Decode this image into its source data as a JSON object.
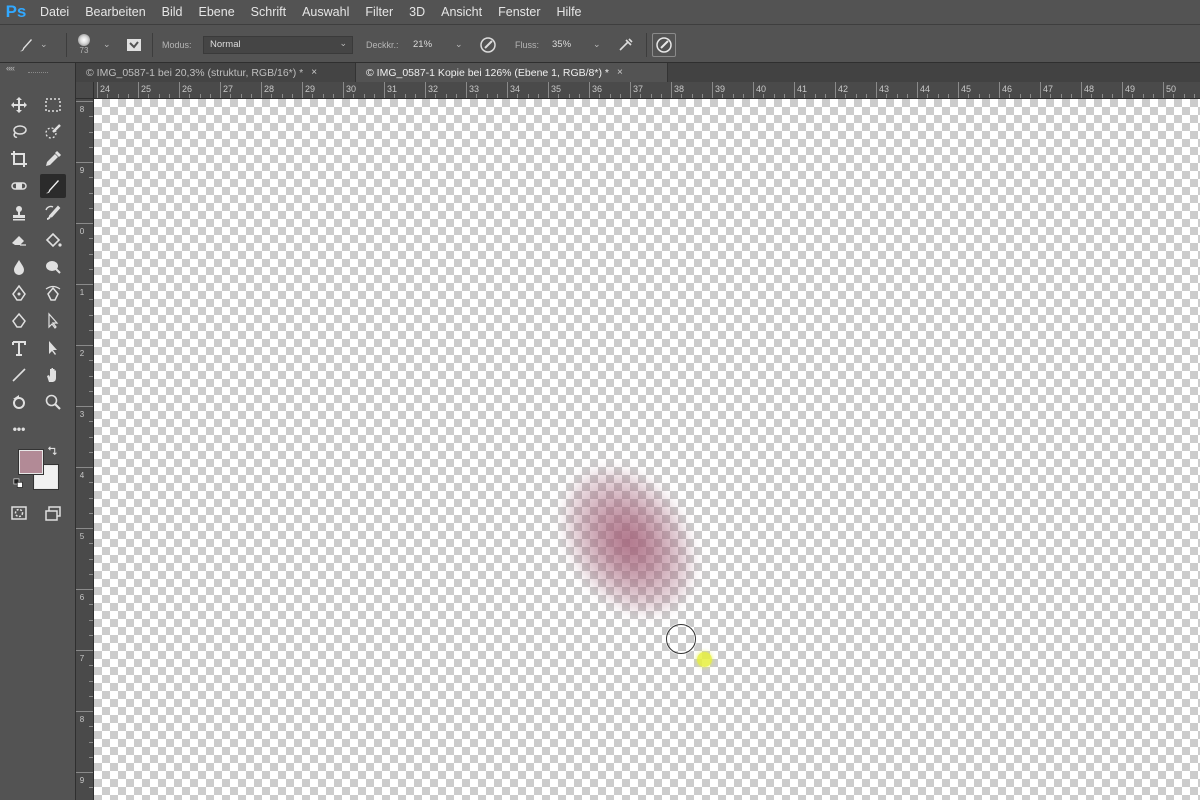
{
  "app": {
    "logo": "Ps"
  },
  "menu": [
    "Datei",
    "Bearbeiten",
    "Bild",
    "Ebene",
    "Schrift",
    "Auswahl",
    "Filter",
    "3D",
    "Ansicht",
    "Fenster",
    "Hilfe"
  ],
  "options": {
    "brush_size": "73",
    "mode_label": "Modus:",
    "mode_value": "Normal",
    "opacity_label": "Deckkr.:",
    "opacity_value": "21%",
    "flow_label": "Fluss:",
    "flow_value": "35%"
  },
  "toolbar": {
    "collapse": "««",
    "more": "•••",
    "foreground_color": "#b28a96",
    "background_color": "#f1f1f1"
  },
  "tabs": [
    {
      "label": "© IMG_0587-1 bei 20,3% (struktur, RGB/16*) *",
      "close": "×",
      "active": false
    },
    {
      "label": "© IMG_0587-1 Kopie bei 126% (Ebene 1, RGB/8*) *",
      "close": "×",
      "active": true
    }
  ],
  "ruler": {
    "horizontal": [
      "24",
      "25",
      "26",
      "27",
      "28",
      "29",
      "30",
      "31",
      "32",
      "33",
      "34",
      "35",
      "36",
      "37",
      "38",
      "39",
      "40",
      "41",
      "42",
      "43",
      "44",
      "45",
      "46",
      "47",
      "48",
      "49",
      "50"
    ],
    "vertical": [
      "8",
      "9",
      "0",
      "1",
      "2",
      "3",
      "4",
      "5",
      "6",
      "7",
      "8",
      "9"
    ]
  },
  "canvas": {
    "stroke_color": "#a05a73",
    "cursor_highlight": "#e6f03c"
  }
}
